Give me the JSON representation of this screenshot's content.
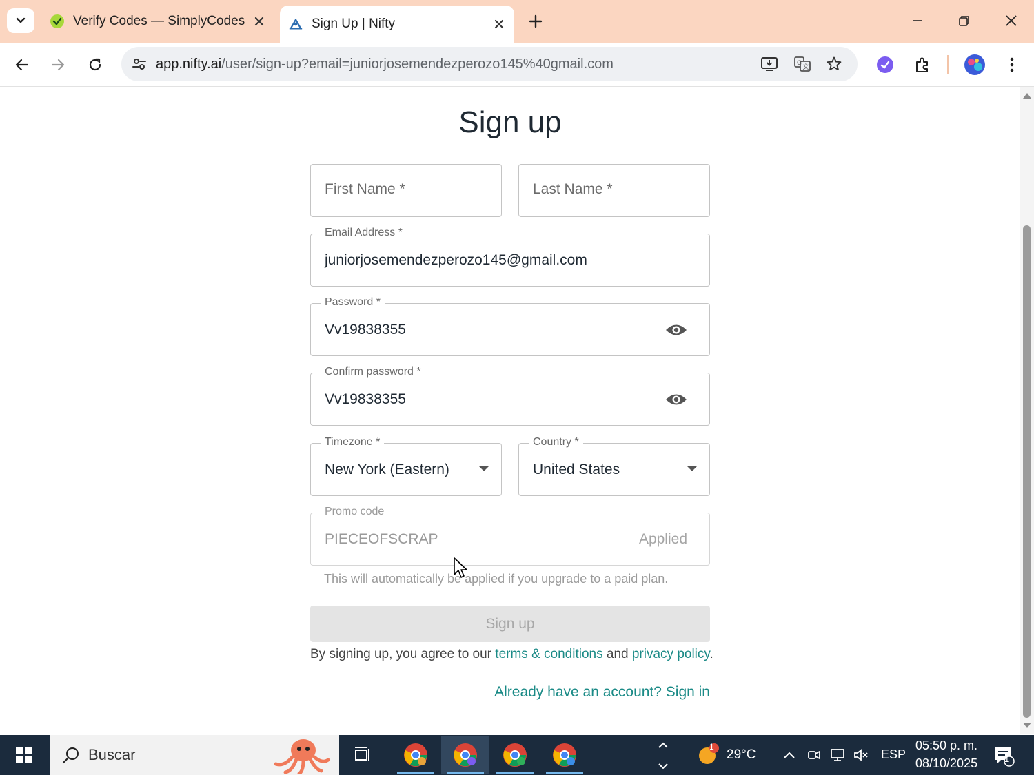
{
  "browser": {
    "tabs": [
      {
        "title": "Verify Codes — SimplyCodes",
        "active": false
      },
      {
        "title": "Sign Up | Nifty",
        "active": true
      }
    ],
    "url": {
      "host": "app.nifty.ai",
      "path": "/user/sign-up?email=juniorjosemendezperozo145%40gmail.com"
    }
  },
  "form": {
    "heading": "Sign up",
    "first_name": {
      "placeholder": "First Name *",
      "value": ""
    },
    "last_name": {
      "placeholder": "Last Name *",
      "value": ""
    },
    "email": {
      "label": "Email Address *",
      "value": "juniorjosemendezperozo145@gmail.com"
    },
    "password": {
      "label": "Password *",
      "value": "Vv19838355"
    },
    "confirm_password": {
      "label": "Confirm password *",
      "value": "Vv19838355"
    },
    "timezone": {
      "label": "Timezone *",
      "value": "New York (Eastern)"
    },
    "country": {
      "label": "Country *",
      "value": "United States"
    },
    "promo": {
      "label": "Promo code",
      "value": "PIECEOFSCRAP",
      "status": "Applied"
    },
    "promo_helper": "This will automatically be applied if you upgrade to a paid plan.",
    "submit_label": "Sign up",
    "agree_prefix": "By signing up, you agree to our ",
    "terms_link": "terms & conditions",
    "agree_mid": " and ",
    "privacy_link": "privacy policy",
    "agree_suffix": ".",
    "signin_link": "Already have an account? Sign in"
  },
  "taskbar": {
    "search_label": "Buscar",
    "weather": "29°C",
    "weather_badge": "1",
    "language": "ESP",
    "time": "05:50 p. m.",
    "date": "08/10/2025",
    "notifications": "1"
  },
  "colors": {
    "tabstrip": "#fbd6c1",
    "accent_link": "#1a8a86",
    "taskbar": "#1b2b3d"
  }
}
